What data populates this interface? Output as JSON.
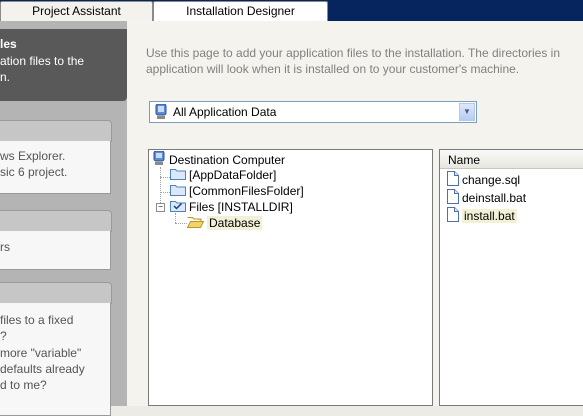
{
  "tabs": [
    {
      "label": "Project Assistant"
    },
    {
      "label": "Installation Designer"
    }
  ],
  "left_panel": {
    "header_title": "les",
    "header_lines": [
      "ation files to the",
      "n."
    ],
    "group1_lines": [
      "ws Explorer.",
      "sic 6 project."
    ],
    "group2_lines": [
      "rs"
    ],
    "group3_lines": [
      "files to a fixed",
      "?",
      "more \"variable\"",
      "defaults already",
      "d to me?"
    ]
  },
  "main": {
    "intro_lines": [
      "Use this page to add your application files to the installation. The directories in",
      "application will look when it is installed on to your customer's machine."
    ],
    "combo_value": "All Application Data",
    "tree": {
      "root": "Destination Computer",
      "items": [
        "[AppDataFolder]",
        "[CommonFilesFolder]",
        "Files [INSTALLDIR]"
      ],
      "child": "Database"
    },
    "files": {
      "column_header": "Name",
      "items": [
        "change.sql",
        "deinstall.bat",
        "install.bat"
      ]
    }
  },
  "colors": {
    "tab_strip": "#06255f",
    "left_pane": "#b4b4b4",
    "header_box": "#595959",
    "folder_blue": "#4f81bd",
    "folder_yellow": "#f2d46b"
  }
}
